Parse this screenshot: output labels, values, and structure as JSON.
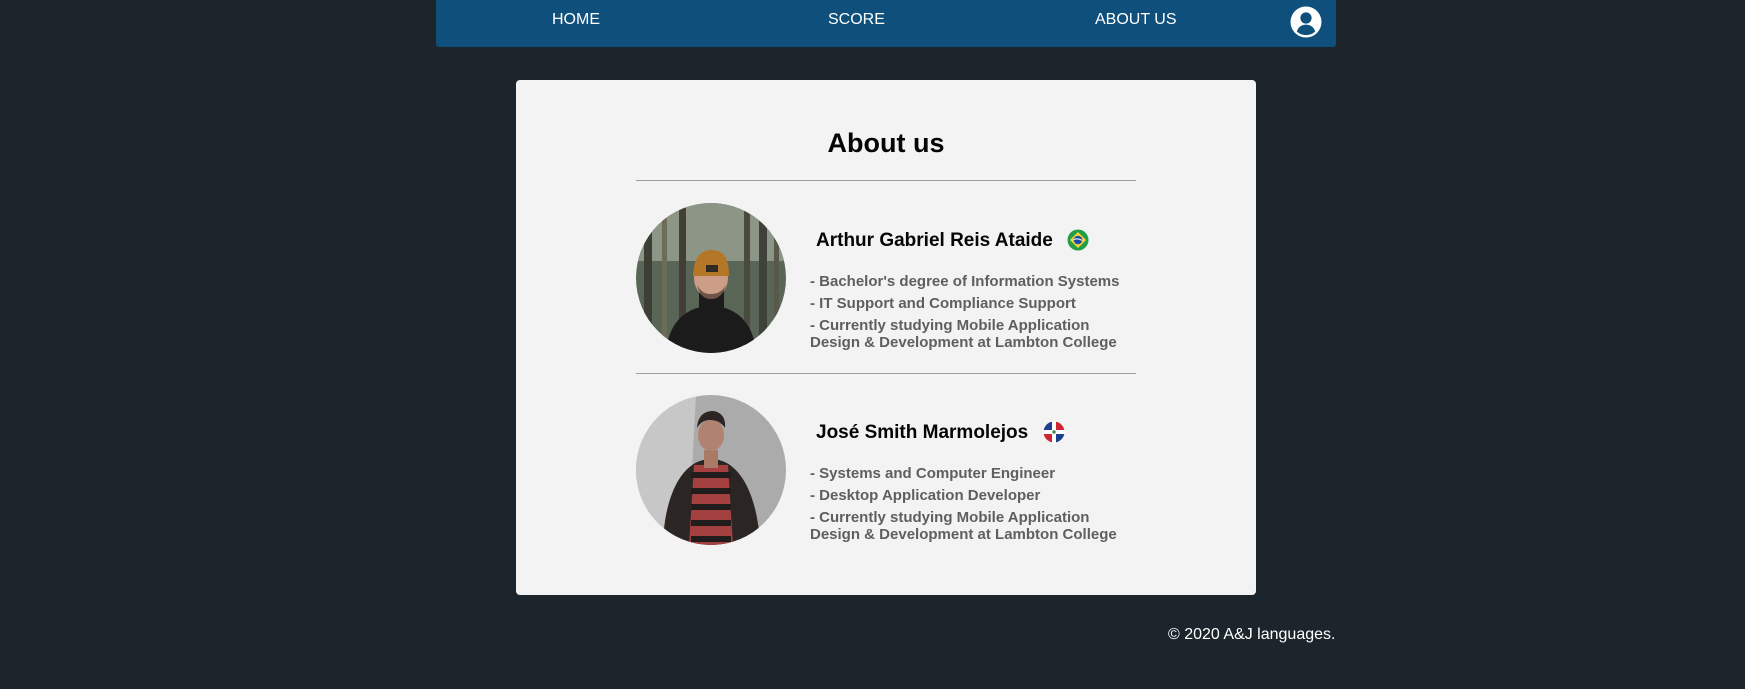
{
  "nav": {
    "home": "HOME",
    "score": "SCORE",
    "about": "ABOUT US",
    "user_icon": "user-circle-icon"
  },
  "about": {
    "title": "About us",
    "members": [
      {
        "name": "Arthur Gabriel Reis Ataide",
        "flag": "brazil-flag-icon",
        "details": [
          "- Bachelor's degree of Information Systems",
          "- IT Support and Compliance Support",
          "- Currently studying Mobile Application Design & Development at Lambton College"
        ]
      },
      {
        "name": "José Smith Marmolejos",
        "flag": "dominican-republic-flag-icon",
        "details": [
          "- Systems and Computer Engineer",
          "- Desktop Application Developer",
          "- Currently studying Mobile Application Design & Development at Lambton College"
        ]
      }
    ]
  },
  "footer": {
    "copyright": "© 2020 A&J languages."
  },
  "colors": {
    "background": "#1b252b",
    "navbar": "#0e4f7b",
    "card": "#f2f3f2",
    "detail_text": "#5e5f60"
  }
}
